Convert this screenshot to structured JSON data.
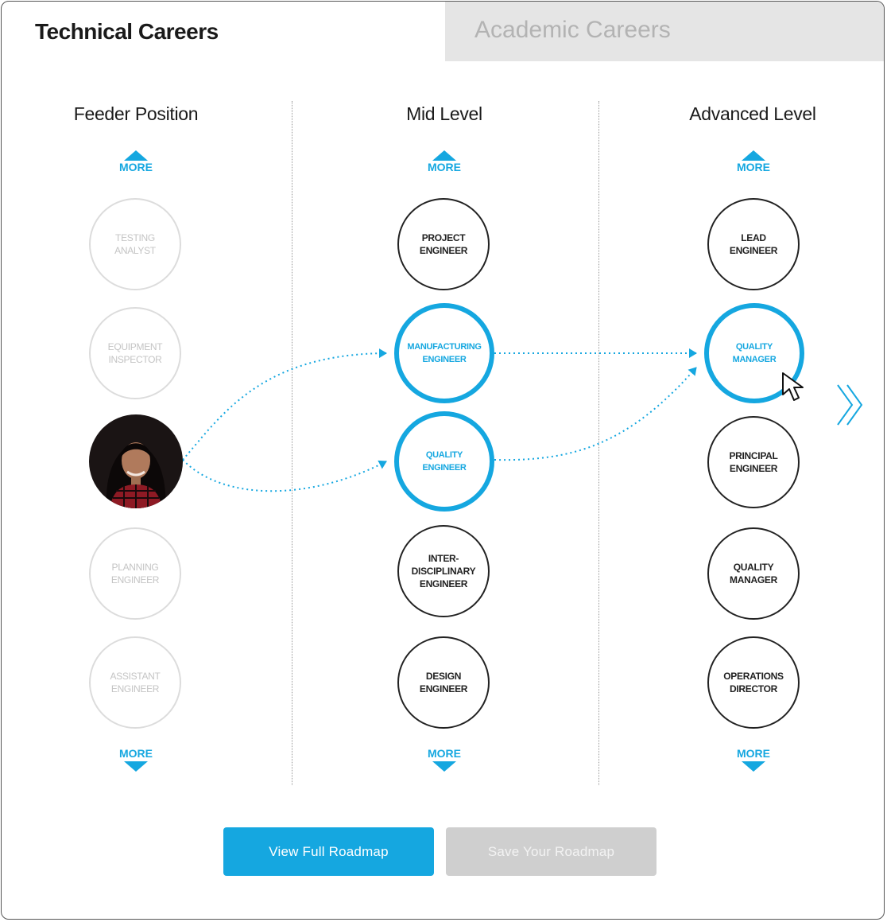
{
  "tabs": {
    "active": "Technical Careers",
    "inactive": "Academic Careers"
  },
  "columns": [
    {
      "title": "Feeder Position",
      "more_top": "MORE",
      "more_bottom": "MORE",
      "nodes": [
        {
          "label": "TESTING\nANALYST",
          "state": "faded"
        },
        {
          "label": "EQUIPMENT\nINSPECTOR",
          "state": "faded"
        },
        {
          "label": "",
          "state": "current-user"
        },
        {
          "label": "PLANNING\nENGINEER",
          "state": "faded"
        },
        {
          "label": "ASSISTANT\nENGINEER",
          "state": "faded"
        }
      ]
    },
    {
      "title": "Mid Level",
      "more_top": "MORE",
      "more_bottom": "MORE",
      "nodes": [
        {
          "label": "PROJECT\nENGINEER",
          "state": "default"
        },
        {
          "label": "MANUFACTURING\nENGINEER",
          "state": "active"
        },
        {
          "label": "QUALITY\nENGINEER",
          "state": "active"
        },
        {
          "label": "INTER-\nDISCIPLINARY\nENGINEER",
          "state": "default"
        },
        {
          "label": "DESIGN\nENGINEER",
          "state": "default"
        }
      ]
    },
    {
      "title": "Advanced Level",
      "more_top": "MORE",
      "more_bottom": "MORE",
      "nodes": [
        {
          "label": "LEAD\nENGINEER",
          "state": "default"
        },
        {
          "label": "QUALITY\nMANAGER",
          "state": "active"
        },
        {
          "label": "PRINCIPAL\nENGINEER",
          "state": "default"
        },
        {
          "label": "QUALITY\nMANAGER",
          "state": "default"
        },
        {
          "label": "OPERATIONS\nDIRECTOR",
          "state": "default"
        }
      ]
    }
  ],
  "buttons": {
    "primary": "View Full Roadmap",
    "secondary": "Save Your Roadmap"
  },
  "icons": {
    "more_up": "triangle-up-icon",
    "more_down": "triangle-down-icon",
    "next": "double-chevron-right-icon",
    "cursor": "mouse-pointer-icon"
  },
  "colors": {
    "accent": "#15a7e0",
    "inactive_tab": "#e5e5e5",
    "disabled_button": "#cfcfcf",
    "faded_node": "#dcdcdc"
  }
}
